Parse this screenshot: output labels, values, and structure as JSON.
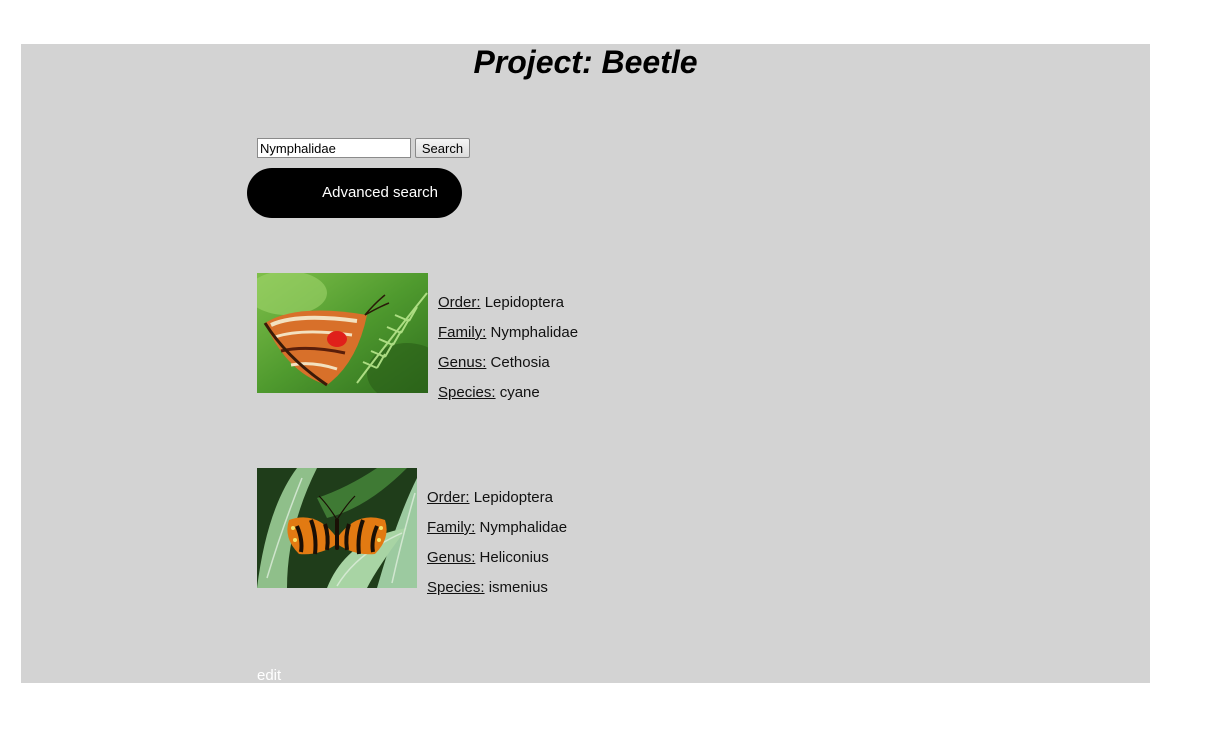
{
  "header": {
    "title": "Project: Beetle"
  },
  "search": {
    "value": "Nymphalidae",
    "button_label": "Search",
    "advanced_label": "Advanced search"
  },
  "results": [
    {
      "image_icon": "butterfly-photo-icon",
      "order_label": "Order:",
      "order": "Lepidoptera",
      "family_label": "Family:",
      "family": "Nymphalidae",
      "genus_label": "Genus:",
      "genus": "Cethosia",
      "species_label": "Species:",
      "species": "cyane"
    },
    {
      "image_icon": "butterfly-photo-icon",
      "order_label": "Order:",
      "order": "Lepidoptera",
      "family_label": "Family:",
      "family": "Nymphalidae",
      "genus_label": "Genus:",
      "genus": "Heliconius",
      "species_label": "Species:",
      "species": "ismenius"
    }
  ],
  "footer": {
    "edit_label": "edit"
  },
  "colors": {
    "panel_bg": "#d3d3d3",
    "button_bg": "#000000",
    "edit_link": "#ffffff"
  }
}
